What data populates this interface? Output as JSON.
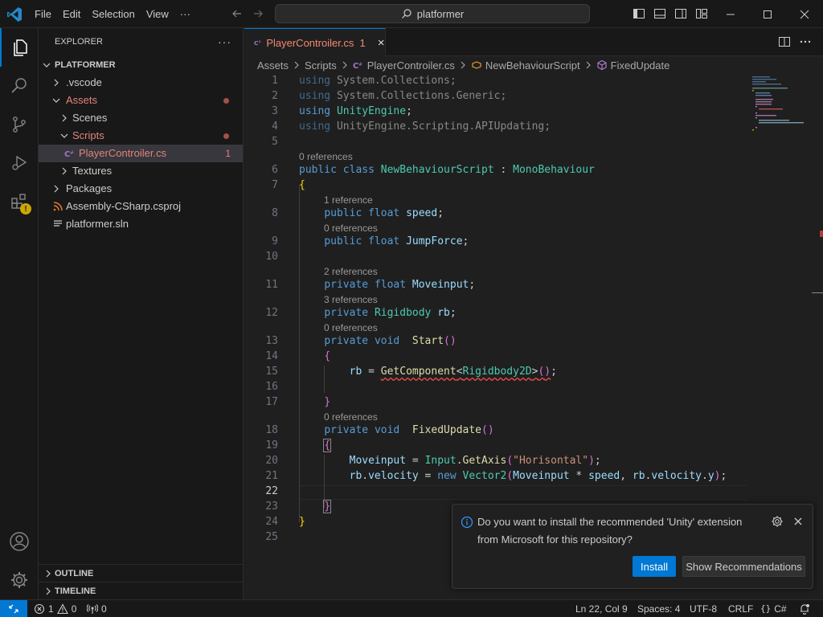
{
  "menu": [
    "File",
    "Edit",
    "Selection",
    "View",
    "···"
  ],
  "search": {
    "text": "platformer"
  },
  "sidebar": {
    "title": "EXPLORER",
    "more": "···",
    "root": "PLATFORMER",
    "tree": [
      {
        "label": ".vscode",
        "type": "folder",
        "open": false,
        "depth": 1,
        "modified": false
      },
      {
        "label": "Assets",
        "type": "folder",
        "open": true,
        "depth": 1,
        "modified": true
      },
      {
        "label": "Scenes",
        "type": "folder",
        "open": false,
        "depth": 2,
        "modified": false
      },
      {
        "label": "Scripts",
        "type": "folder",
        "open": true,
        "depth": 2,
        "modified": true
      },
      {
        "label": "PlayerControiler.cs",
        "type": "cs",
        "depth": 3,
        "selected": true,
        "count": "1"
      },
      {
        "label": "Textures",
        "type": "folder",
        "open": false,
        "depth": 2,
        "modified": false
      },
      {
        "label": "Packages",
        "type": "folder",
        "open": false,
        "depth": 1,
        "modified": false
      },
      {
        "label": "Assembly-CSharp.csproj",
        "type": "rss",
        "depth": 1
      },
      {
        "label": "platformer.sln",
        "type": "sln",
        "depth": 1
      }
    ],
    "outline": "OUTLINE",
    "timeline": "TIMELINE"
  },
  "tab": {
    "label": "PlayerControiler.cs",
    "count": "1"
  },
  "breadcrumb": [
    "Assets",
    "Scripts",
    "PlayerControiler.cs",
    "NewBehaviourScript",
    "FixedUpdate"
  ],
  "editor": {
    "line_numbers": [
      "1",
      "2",
      "3",
      "4",
      "5",
      "6",
      "7",
      "8",
      "9",
      "10",
      "11",
      "12",
      "13",
      "14",
      "15",
      "16",
      "17",
      "18",
      "19",
      "20",
      "21",
      "22",
      "23",
      "24",
      "25"
    ],
    "current_line": "22",
    "lenses": [
      "0 references",
      "1 reference",
      "0 references",
      "2 references",
      "3 references",
      "0 references",
      "0 references"
    ],
    "lines": [
      "using System.Collections;",
      "using System.Collections.Generic;",
      "using UnityEngine;",
      "using UnityEngine.Scripting.APIUpdating;",
      "",
      "public class NewBehaviourScript : MonoBehaviour",
      "{",
      "    public float speed;",
      "    public float JumpForce;",
      "",
      "    private float Moveinput;",
      "    private Rigidbody rb;",
      "    private void  Start()",
      "    {",
      "        rb = GetComponent<Rigidbody2D>();",
      "",
      "    }",
      "    private void  FixedUpdate()",
      "    {",
      "        Moveinput = Input.GetAxis(\"Horisontal\");",
      "        rb.velocity = new Vector2(Moveinput * speed, rb.velocity.y);",
      "",
      "    }",
      "}",
      ""
    ]
  },
  "notification": {
    "message": "Do you want to install the recommended 'Unity' extension from Microsoft for this repository?",
    "install": "Install",
    "show": "Show Recommendations"
  },
  "status": {
    "errors": "1",
    "warnings": "0",
    "ports": "0",
    "position": "Ln 22, Col 9",
    "spaces": "Spaces: 4",
    "encoding": "UTF-8",
    "eol": "CRLF",
    "language": "C#"
  },
  "colors": {
    "accent": "#0078d4",
    "error": "#f14c4c",
    "modified": "#f48771"
  }
}
